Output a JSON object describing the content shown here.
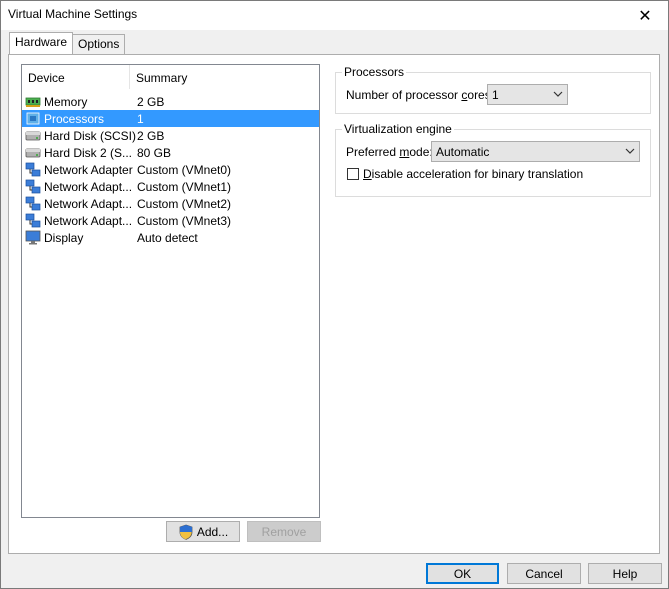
{
  "window": {
    "title": "Virtual Machine Settings",
    "close_glyph": "✕"
  },
  "tabs": [
    {
      "label": "Hardware",
      "active": true
    },
    {
      "label": "Options",
      "active": false
    }
  ],
  "device_list": {
    "columns": [
      "Device",
      "Summary"
    ],
    "rows": [
      {
        "device": "Memory",
        "summary": "2 GB",
        "icon": "memory-icon",
        "selected": false
      },
      {
        "device": "Processors",
        "summary": "1",
        "icon": "processor-icon",
        "selected": true
      },
      {
        "device": "Hard Disk (SCSI)",
        "summary": "2 GB",
        "icon": "hard-disk-icon",
        "selected": false
      },
      {
        "device": "Hard Disk 2 (S...",
        "summary": "80 GB",
        "icon": "hard-disk-icon",
        "selected": false
      },
      {
        "device": "Network Adapter",
        "summary": "Custom (VMnet0)",
        "icon": "network-adapter-icon",
        "selected": false
      },
      {
        "device": "Network Adapt...",
        "summary": "Custom (VMnet1)",
        "icon": "network-adapter-icon",
        "selected": false
      },
      {
        "device": "Network Adapt...",
        "summary": "Custom (VMnet2)",
        "icon": "network-adapter-icon",
        "selected": false
      },
      {
        "device": "Network Adapt...",
        "summary": "Custom (VMnet3)",
        "icon": "network-adapter-icon",
        "selected": false
      },
      {
        "device": "Display",
        "summary": "Auto detect",
        "icon": "display-icon",
        "selected": false
      }
    ]
  },
  "list_buttons": {
    "add": "Add...",
    "remove": "Remove"
  },
  "processors": {
    "group_title": "Processors",
    "cores_label_pre": "Number of processor ",
    "cores_label_u": "c",
    "cores_label_post": "ores:",
    "cores_value": "1"
  },
  "virtualization": {
    "group_title": "Virtualization engine",
    "mode_label_pre": "Preferred ",
    "mode_label_u": "m",
    "mode_label_post": "ode:",
    "mode_value": "Automatic",
    "disable_accel_u": "D",
    "disable_accel_rest": "isable acceleration for binary translation",
    "disable_accel_checked": false
  },
  "footer": {
    "ok": "OK",
    "cancel": "Cancel",
    "help": "Help"
  },
  "colors": {
    "selection": "#3399ff",
    "accent": "#0078d7"
  }
}
